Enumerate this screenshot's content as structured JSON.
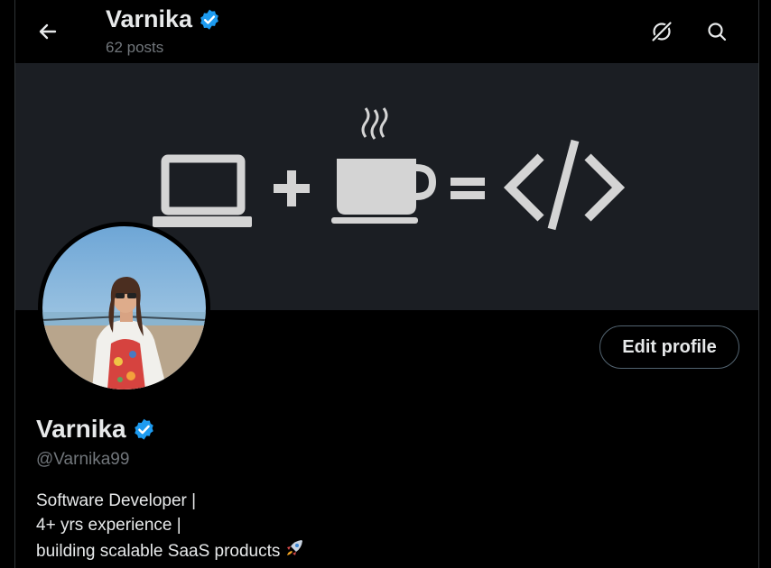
{
  "header": {
    "name": "Varnika",
    "posts": "62 posts",
    "icons": {
      "back": "arrow-left-icon",
      "grok": "grok-icon",
      "search": "search-icon"
    }
  },
  "banner": {
    "description_icons": [
      "laptop-icon",
      "plus-icon",
      "coffee-cup-icon",
      "equals-icon",
      "code-icon"
    ]
  },
  "profile": {
    "name": "Varnika",
    "handle": "@Varnika99",
    "verified": true,
    "edit_label": "Edit profile",
    "bio_lines": [
      "Software Developer |",
      "4+ yrs experience |",
      "building scalable SaaS products"
    ],
    "bio_emoji": "rocket-emoji"
  },
  "colors": {
    "background": "#000000",
    "text": "#e7e9ea",
    "muted": "#71767b",
    "verified": "#1d9bf0",
    "banner": "#1b1e23"
  }
}
